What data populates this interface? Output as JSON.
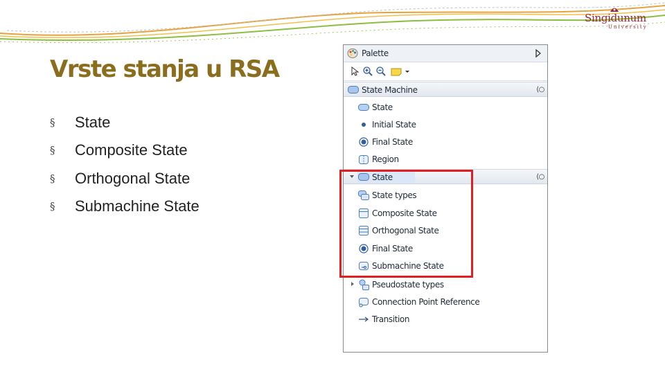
{
  "slide": {
    "title": "Vrste stanja u RSA",
    "bullet_glyph": "§",
    "bullets": [
      "State",
      "Composite State",
      "Orthogonal State",
      "Submachine State"
    ]
  },
  "logo": {
    "name": "Singidunum",
    "subtitle": "University",
    "color": "#9b2335"
  },
  "palette": {
    "title": "Palette",
    "toolbar_icons": [
      "select-arrow-icon",
      "zoom-in-icon",
      "zoom-out-icon",
      "note-icon",
      "dropdown-arrow-icon"
    ],
    "drawers": [
      {
        "label": "State Machine",
        "items": [
          {
            "label": "State",
            "icon": "state-icon"
          },
          {
            "label": "Initial State",
            "icon": "initial-state-icon"
          },
          {
            "label": "Final State",
            "icon": "final-state-icon"
          },
          {
            "label": "Region",
            "icon": "region-icon"
          }
        ]
      },
      {
        "label": "State",
        "items": [
          {
            "label": "State types",
            "icon": "state-types-icon"
          },
          {
            "label": "Composite State",
            "icon": "composite-state-icon"
          },
          {
            "label": "Orthogonal State",
            "icon": "orthogonal-state-icon"
          },
          {
            "label": "Final State",
            "icon": "final-state-icon"
          },
          {
            "label": "Submachine State",
            "icon": "submachine-state-icon"
          },
          {
            "label": "Pseudostate types",
            "icon": "pseudostate-types-icon"
          },
          {
            "label": "Connection Point Reference",
            "icon": "connection-point-icon"
          },
          {
            "label": "Transition",
            "icon": "transition-arrow-icon"
          }
        ]
      }
    ]
  },
  "colors": {
    "title": "#8a6d1d",
    "highlight": "#e02020",
    "state_blue": "#4a7fc0"
  }
}
